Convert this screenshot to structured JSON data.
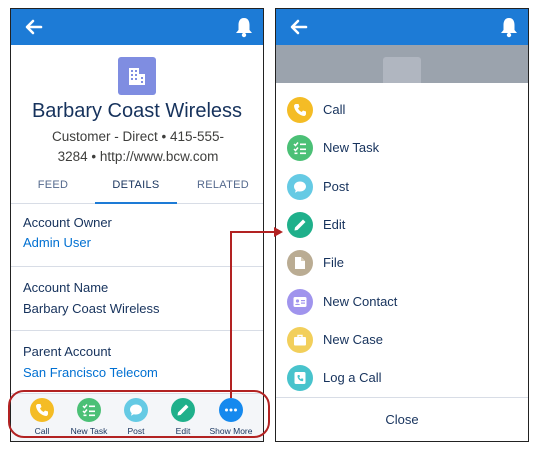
{
  "left_screen": {
    "account": {
      "name": "Barbary Coast Wireless",
      "subtitle_line1": "Customer - Direct • 415-555-",
      "subtitle_line2": "3284 • http://www.bcw.com"
    },
    "tabs": [
      "FEED",
      "DETAILS",
      "RELATED"
    ],
    "active_tab": "DETAILS",
    "fields": [
      {
        "label": "Account Owner",
        "value": "Admin User",
        "is_link": true
      },
      {
        "label": "Account Name",
        "value": "Barbary Coast Wireless",
        "is_link": false
      },
      {
        "label": "Parent Account",
        "value": "San Francisco Telecom",
        "is_link": true
      }
    ],
    "action_bar": [
      {
        "label": "Call",
        "icon": "phone-icon",
        "color": "#f4bc25"
      },
      {
        "label": "New Task",
        "icon": "task-list-icon",
        "color": "#4bc076"
      },
      {
        "label": "Post",
        "icon": "chat-bubble-icon",
        "color": "#65cae4"
      },
      {
        "label": "Edit",
        "icon": "pencil-icon",
        "color": "#1fb08b"
      },
      {
        "label": "Show More",
        "icon": "more-dots-icon",
        "color": "#1589ee"
      }
    ]
  },
  "right_screen": {
    "menu": [
      {
        "label": "Call",
        "icon": "phone-icon",
        "color": "#f4bc25"
      },
      {
        "label": "New Task",
        "icon": "task-list-icon",
        "color": "#4bc076"
      },
      {
        "label": "Post",
        "icon": "chat-bubble-icon",
        "color": "#65cae4"
      },
      {
        "label": "Edit",
        "icon": "pencil-icon",
        "color": "#1fb08b"
      },
      {
        "label": "File",
        "icon": "file-icon",
        "color": "#baac93"
      },
      {
        "label": "New Contact",
        "icon": "contact-card-icon",
        "color": "#a094ed"
      },
      {
        "label": "New Case",
        "icon": "briefcase-icon",
        "color": "#f2cf5b"
      },
      {
        "label": "Log a Call",
        "icon": "log-call-icon",
        "color": "#48c3cc"
      }
    ],
    "close_label": "Close"
  },
  "colors": {
    "header_blue": "#1d7bd6",
    "account_icon": "#7f8de1",
    "link_blue": "#0070d2",
    "callout_red": "#b22222"
  }
}
